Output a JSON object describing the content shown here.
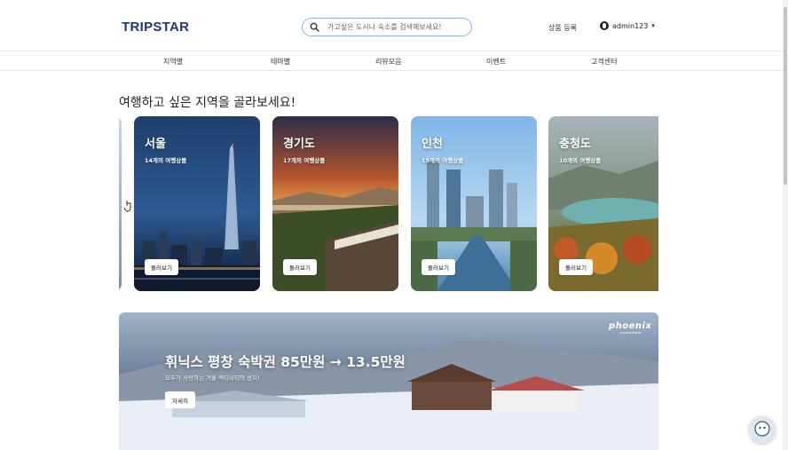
{
  "header": {
    "logo": "TRIPSTAR",
    "search_placeholder": "가고싶은 도시나 숙소를 검색해보세요!",
    "product_register": "상품 등록",
    "username": "admin123"
  },
  "nav": {
    "items": [
      {
        "label": "지역별"
      },
      {
        "label": "테마별"
      },
      {
        "label": "리뷰모음"
      },
      {
        "label": "이벤트"
      },
      {
        "label": "고객센터"
      }
    ]
  },
  "regions": {
    "title": "여행하고 싶은 지역을 골라보세요!",
    "cards": [
      {
        "name": "서울",
        "count": "14개의 여행상품",
        "button": "둘러보기"
      },
      {
        "name": "경기도",
        "count": "17개의 여행상품",
        "button": "둘러보기"
      },
      {
        "name": "인천",
        "count": "15개의 여행상품",
        "button": "둘러보기"
      },
      {
        "name": "충청도",
        "count": "10개의 여행상품",
        "button": "둘러보기"
      }
    ]
  },
  "banner": {
    "title": "휘닉스 평창 숙박권 85만원 → 13.5만원",
    "subtitle": "모두가 사랑하는 겨울 액티비티의 성지!",
    "button": "자세히",
    "brand_name": "phoenix",
    "brand_tag": "pyeongchang"
  },
  "colors": {
    "logo": "#1b3a78",
    "search_border": "#7bb8f0"
  }
}
